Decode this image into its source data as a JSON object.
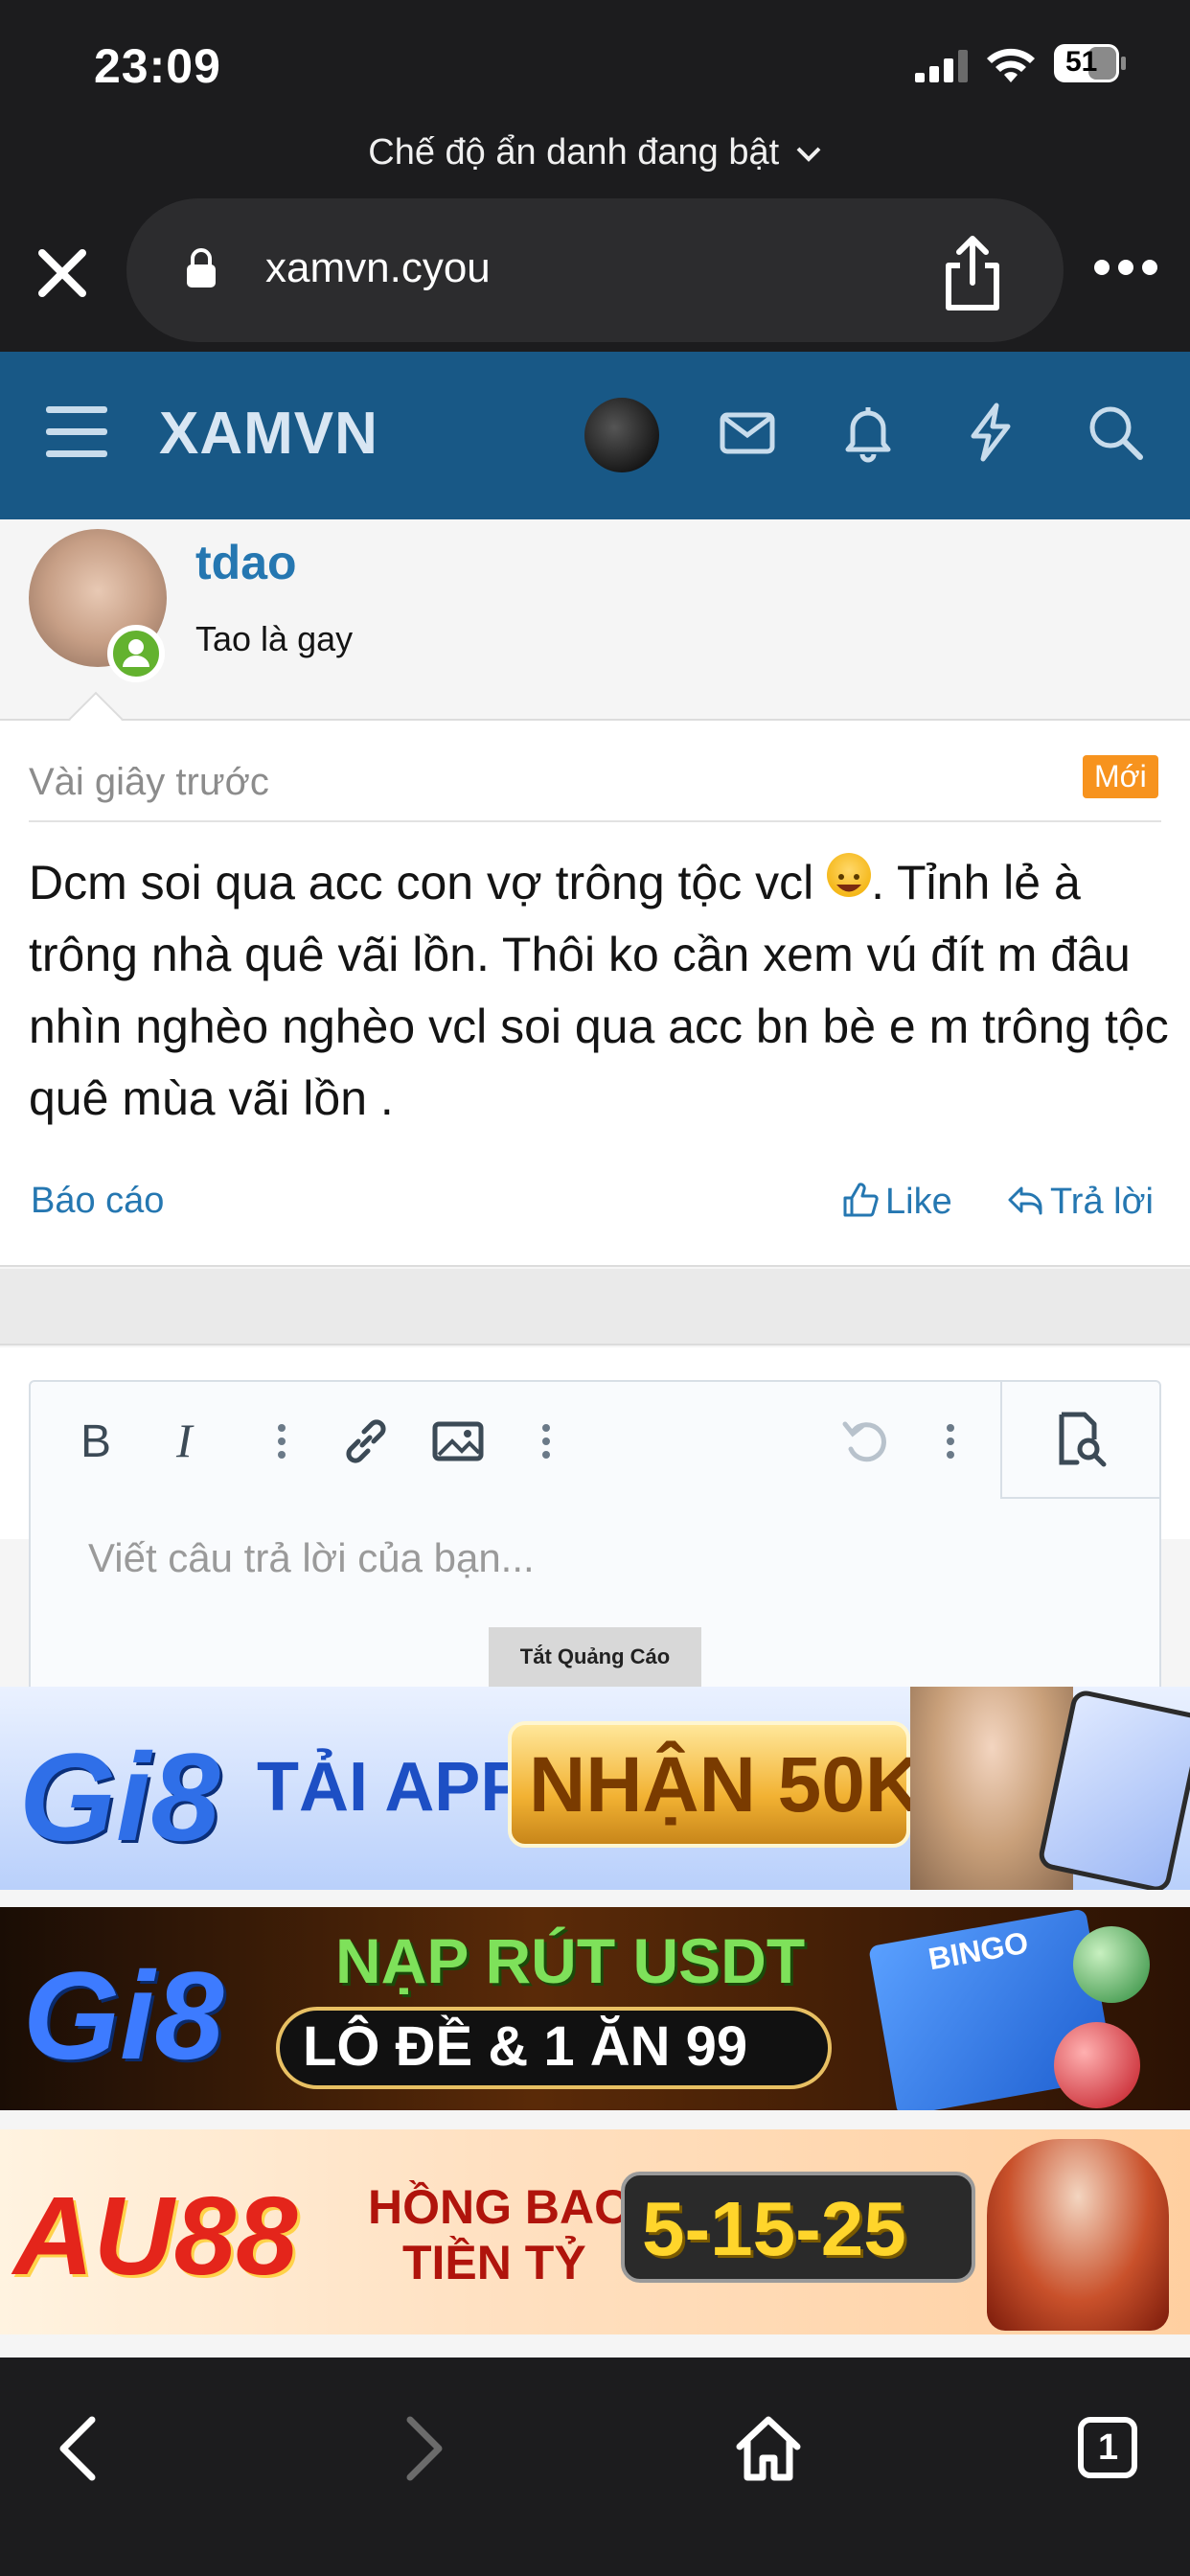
{
  "status_bar": {
    "time": "23:09",
    "battery": "51"
  },
  "browser": {
    "private_mode_label": "Chế độ ẩn danh đang bật",
    "url": "xamvn.cyou"
  },
  "header": {
    "logo": "XAMVN"
  },
  "post": {
    "author": "tdao",
    "author_title": "Tao là gay",
    "time": "Vài giây trước",
    "badge": "Mới",
    "body_part1": "Dcm soi qua acc con vợ trông tộc vcl ",
    "body_part2": ". Tỉnh lẻ à trông nhà quê vãi lồn. Thôi ko cần xem vú đít m đâu nhìn nghèo nghèo vcl soi qua acc bn bè e m trông tộc quê mùa vãi lồn .",
    "report": "Báo cáo",
    "like": "Like",
    "reply": "Trả lời"
  },
  "editor": {
    "placeholder": "Viết câu trả lời của bạn..."
  },
  "ads": {
    "toggle_label": "Tắt Quảng Cáo",
    "banner1": {
      "logo": "Gi8",
      "text1": "TẢI APP",
      "text2": "NHẬN 50K"
    },
    "banner2": {
      "logo": "Gi8",
      "text1": "NẠP RÚT USDT",
      "text2": "LÔ ĐỀ & 1 ĂN 99",
      "badge": "BINGO"
    },
    "banner3": {
      "logo": "AU88",
      "text1": "HỒNG BAO",
      "text2": "TIỀN TỶ",
      "text3": "5-15-25"
    }
  },
  "bottom_nav": {
    "tab_count": "1"
  }
}
